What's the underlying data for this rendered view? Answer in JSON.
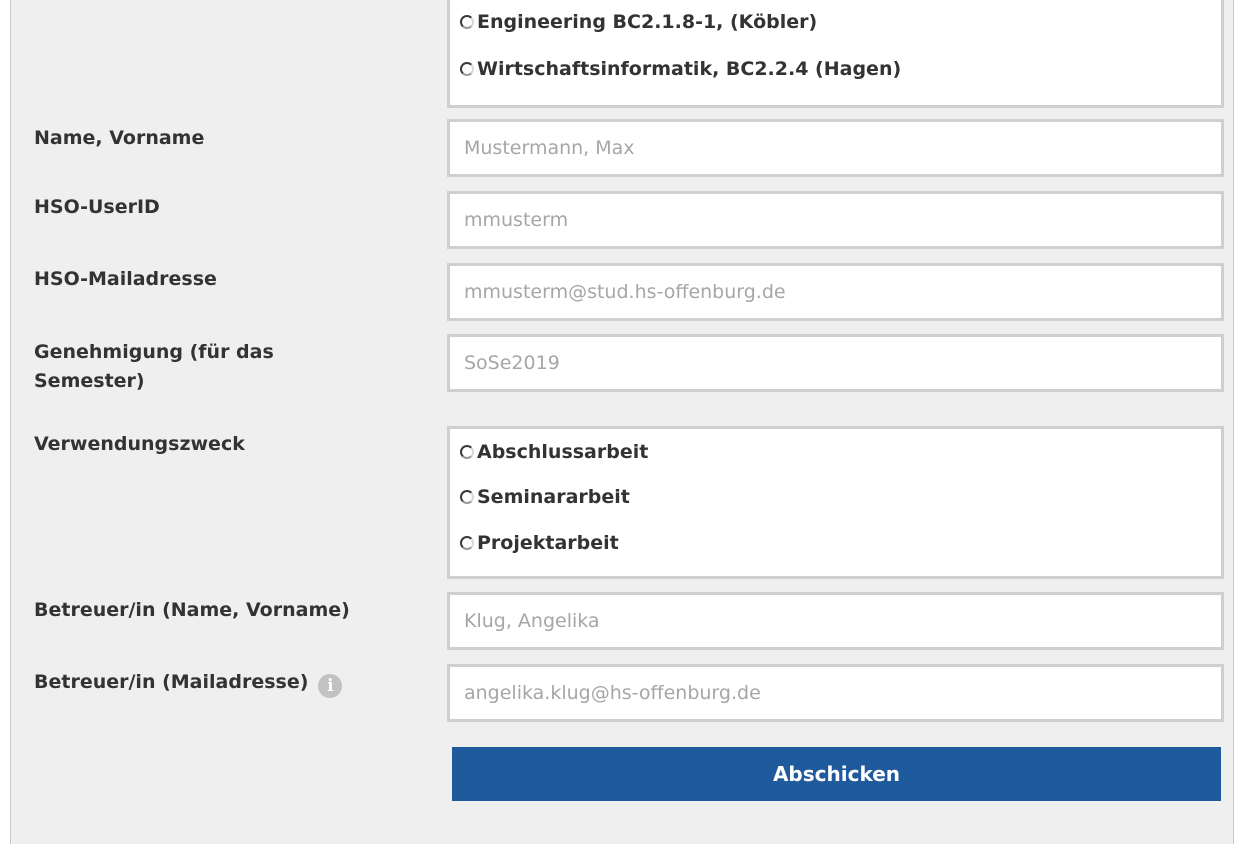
{
  "studiengang": {
    "options": [
      "Engineering BC2.1.8-1, (Köbler)",
      "Wirtschaftsinformatik, BC2.2.4 (Hagen)"
    ]
  },
  "fields": {
    "name": {
      "label": "Name, Vorname",
      "placeholder": "Mustermann, Max"
    },
    "userid": {
      "label": "HSO-UserID",
      "placeholder": "mmusterm"
    },
    "mail": {
      "label": "HSO-Mailadresse",
      "placeholder": "mmusterm@stud.hs-offenburg.de"
    },
    "semester": {
      "label": "Genehmigung (für das Semester)",
      "placeholder": "SoSe2019"
    },
    "betreuer_name": {
      "label": "Betreuer/in (Name, Vorname)",
      "placeholder": "Klug, Angelika"
    },
    "betreuer_mail": {
      "label": "Betreuer/in (Mailadresse)",
      "placeholder": "angelika.klug@hs-offenburg.de"
    }
  },
  "zweck": {
    "label": "Verwendungszweck",
    "options": [
      "Abschlussarbeit",
      "Seminararbeit",
      "Projektarbeit"
    ]
  },
  "info_icon": "info-icon",
  "submit_label": "Abschicken",
  "colors": {
    "panel_bg": "#efefef",
    "button_bg": "#1f5a9c",
    "input_border": "#cfcfcf",
    "placeholder": "#a6a6a6"
  }
}
